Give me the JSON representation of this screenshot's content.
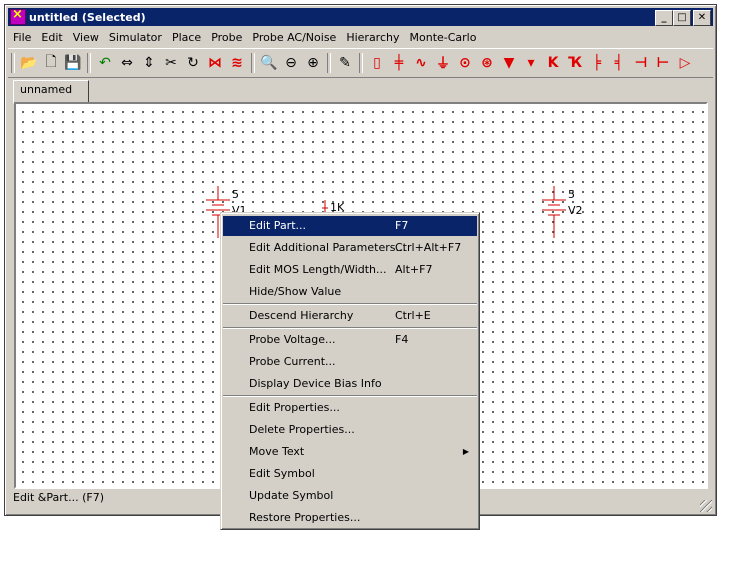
{
  "window": {
    "title": "untitled (Selected)"
  },
  "menubar": [
    "File",
    "Edit",
    "View",
    "Simulator",
    "Place",
    "Probe",
    "Probe AC/Noise",
    "Hierarchy",
    "Monte-Carlo"
  ],
  "tabs": [
    "unnamed"
  ],
  "parts": {
    "v1": {
      "name": "V1",
      "value": "5"
    },
    "r1": {
      "value": "1K"
    },
    "v2": {
      "name": "V2",
      "value": "5"
    }
  },
  "status_text": "Edit &Part... (F7)",
  "context_menu": {
    "groups": [
      [
        {
          "label": "Edit Part...",
          "shortcut": "F7",
          "highlighted": true
        },
        {
          "label": "Edit Additional Parameters...",
          "shortcut": "Ctrl+Alt+F7"
        },
        {
          "label": "Edit MOS Length/Width...",
          "shortcut": "Alt+F7"
        },
        {
          "label": "Hide/Show Value",
          "shortcut": ""
        }
      ],
      [
        {
          "label": "Descend Hierarchy",
          "shortcut": "Ctrl+E"
        }
      ],
      [
        {
          "label": "Probe Voltage...",
          "shortcut": "F4"
        },
        {
          "label": "Probe Current...",
          "shortcut": ""
        },
        {
          "label": "Display Device Bias Info",
          "shortcut": ""
        }
      ],
      [
        {
          "label": "Edit Properties...",
          "shortcut": ""
        },
        {
          "label": "Delete Properties...",
          "shortcut": ""
        },
        {
          "label": "Move Text",
          "shortcut": "",
          "submenu": true
        },
        {
          "label": "Edit Symbol",
          "shortcut": ""
        },
        {
          "label": "Update Symbol",
          "shortcut": ""
        },
        {
          "label": "Restore Properties...",
          "shortcut": ""
        }
      ]
    ]
  },
  "colors": {
    "titlebar": "#0a246a",
    "highlight": "#0a246a",
    "part": "#d00000",
    "face": "#d4d0c8"
  }
}
